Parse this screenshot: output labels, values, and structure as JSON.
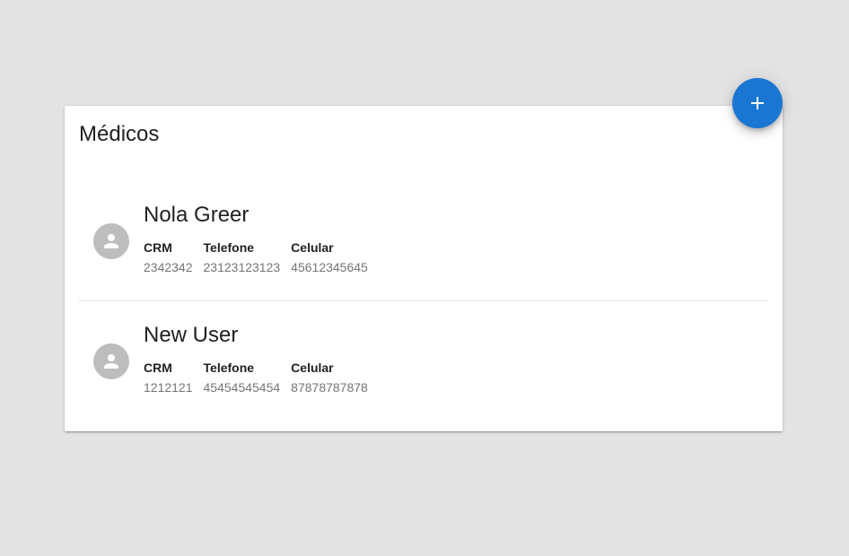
{
  "page": {
    "title": "Médicos",
    "add_button_icon": "plus-icon"
  },
  "colors": {
    "background": "#e3e3e3",
    "card": "#ffffff",
    "accent": "#1976d2",
    "avatar": "#bdbdbd"
  },
  "doctors": [
    {
      "name": "Nola Greer",
      "avatar_icon": "person-icon",
      "fields": [
        {
          "label": "CRM",
          "value": "2342342"
        },
        {
          "label": "Telefone",
          "value": "23123123123"
        },
        {
          "label": "Celular",
          "value": "45612345645"
        }
      ]
    },
    {
      "name": "New User",
      "avatar_icon": "person-icon",
      "fields": [
        {
          "label": "CRM",
          "value": "1212121"
        },
        {
          "label": "Telefone",
          "value": "45454545454"
        },
        {
          "label": "Celular",
          "value": "87878787878"
        }
      ]
    }
  ]
}
